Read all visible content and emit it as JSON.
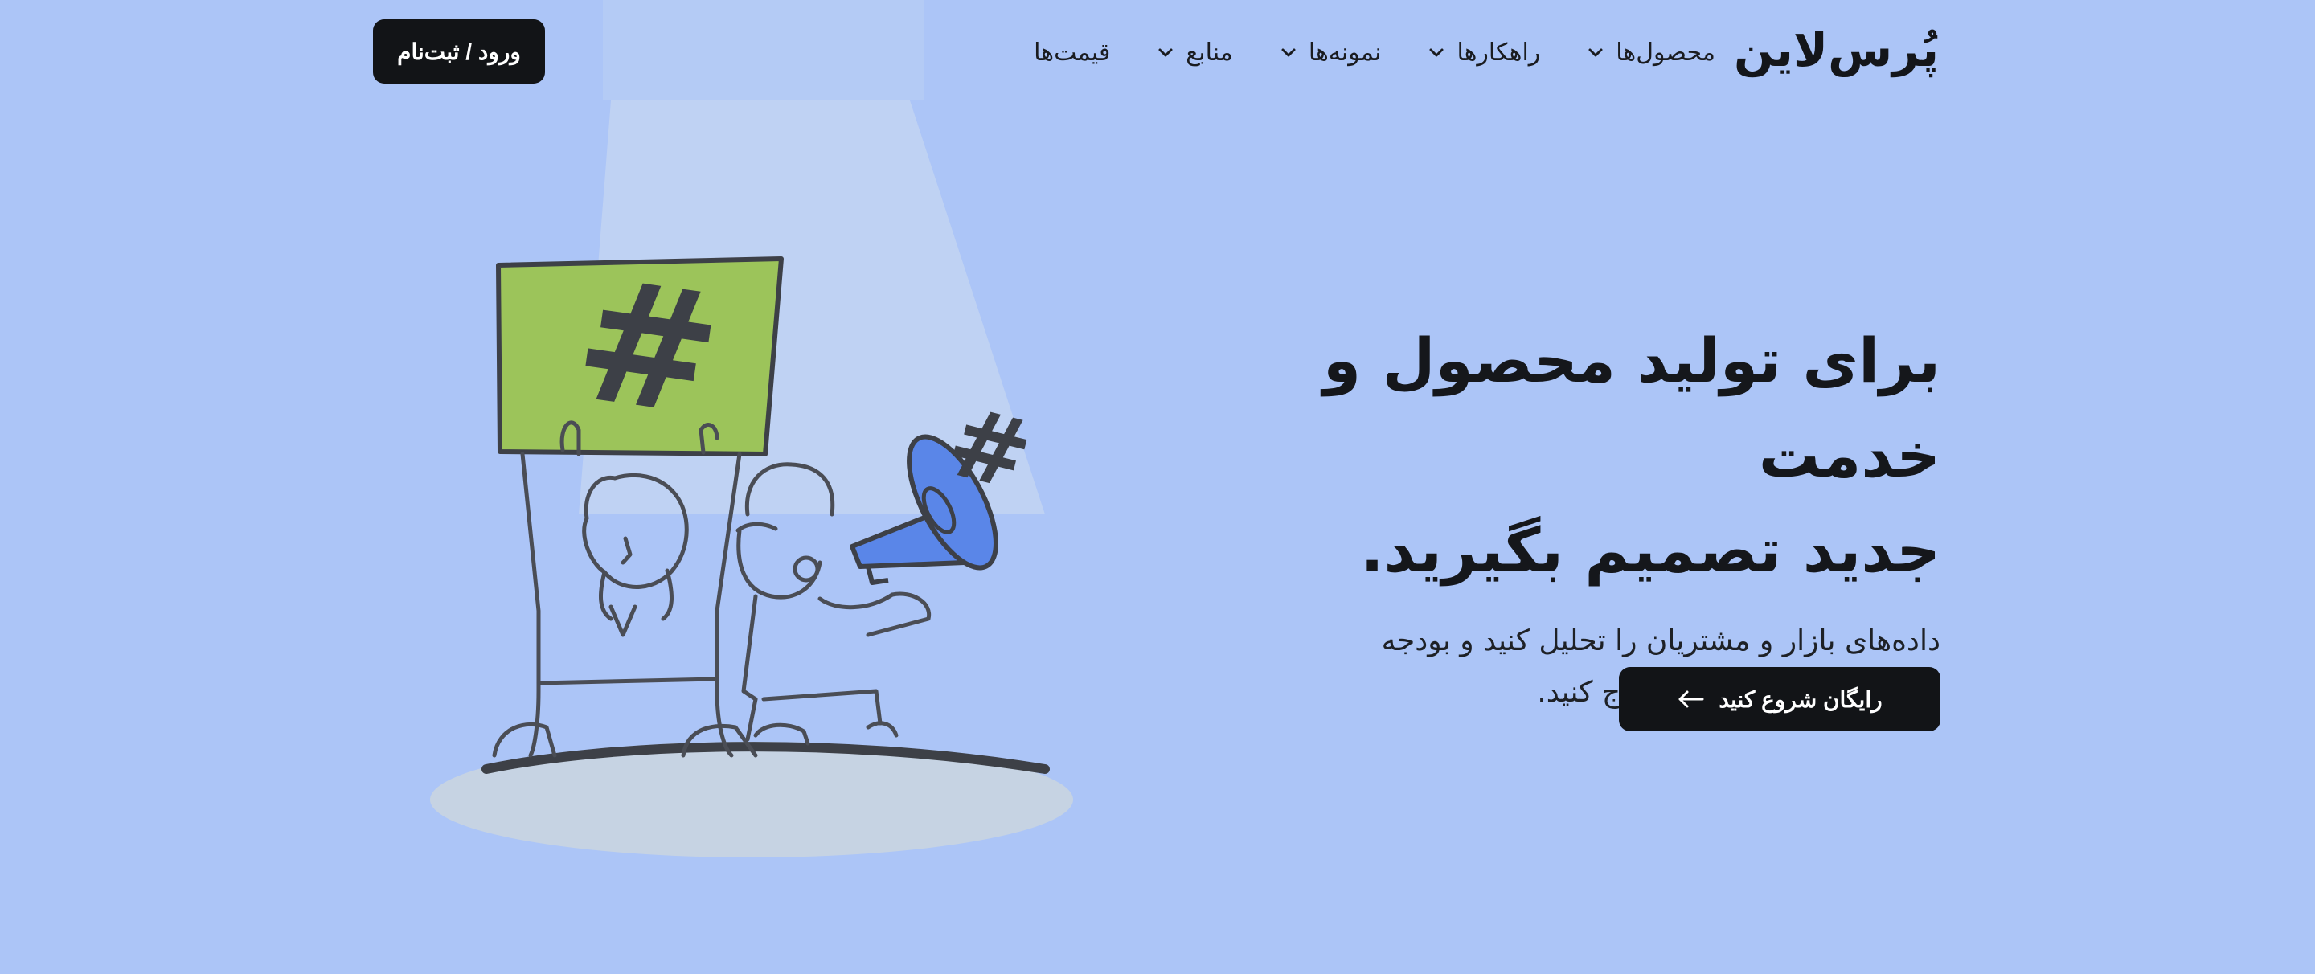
{
  "header": {
    "logo": "پُرس‌لاین",
    "nav": [
      {
        "label": "محصول‌ها"
      },
      {
        "label": "راهکارها"
      },
      {
        "label": "نمونه‌ها"
      },
      {
        "label": "منابع"
      },
      {
        "label": "قیمت‌ها"
      }
    ],
    "login_label": "ورود / ثبت‌نام"
  },
  "hero": {
    "headline_line1": "برای تولید محصول و خدمت",
    "headline_line2": "جدید تصمیم بگیرید.",
    "subtext_line1": "داده‌های بازار و مشتریان را تحلیل کنید و بودجه",
    "subtext_line2": "بازاریابی خود را درست خرج کنید.",
    "cta_label": "رایگان شروع کنید"
  },
  "colors": {
    "background": "#acc5f7",
    "button": "#121417",
    "sign_green": "#9cc45a",
    "megaphone_blue": "#5a86e8"
  },
  "icons": {
    "nav_dropdown": "chevron-down-icon",
    "cta_arrow": "arrow-left-icon"
  }
}
